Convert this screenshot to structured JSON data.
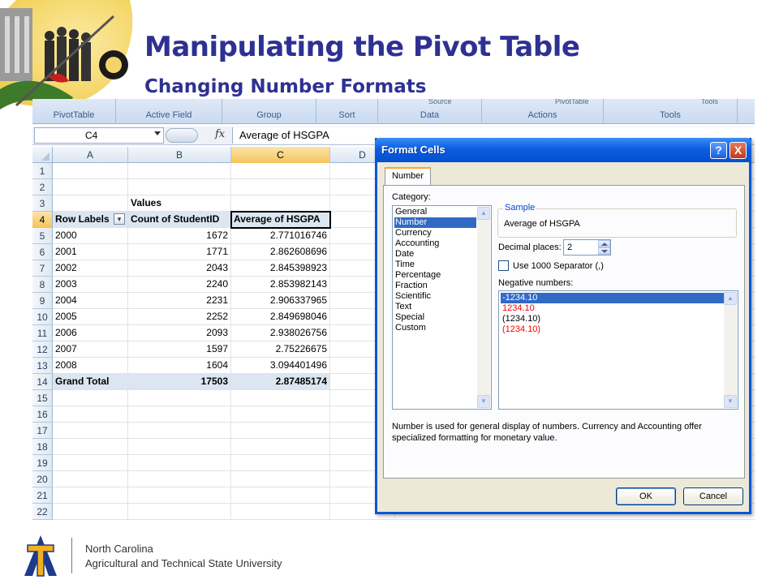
{
  "slide": {
    "title": "Manipulating the Pivot Table",
    "subtitle": "Changing Number Formats",
    "footer_line1": "North Carolina",
    "footer_line2": "Agricultural and Technical State University",
    "colors": {
      "title": "#2e3192",
      "logo_blue": "#1e3a8a",
      "logo_gold": "#f2b01e"
    }
  },
  "ribbon": {
    "groups": [
      "PivotTable",
      "Active Field",
      "Group",
      "Sort",
      "Data",
      "Actions",
      "Tools"
    ],
    "clipped_top": [
      "Source",
      "PivotTable",
      "Tools"
    ]
  },
  "formula_bar": {
    "name_box": "C4",
    "fx": "fx",
    "formula": "Average of HSGPA"
  },
  "sheet": {
    "columns": [
      "A",
      "B",
      "C",
      "D"
    ],
    "active_column": "C",
    "active_row": "4",
    "row_numbers": [
      "1",
      "2",
      "3",
      "4",
      "5",
      "6",
      "7",
      "8",
      "9",
      "10",
      "11",
      "12",
      "13",
      "14",
      "15",
      "16",
      "17",
      "18",
      "19",
      "20",
      "21",
      "22"
    ],
    "values_header": "Values",
    "headers": [
      "Row Labels",
      "Count of StudentID",
      "Average of HSGPA"
    ],
    "rows": [
      {
        "label": "2000",
        "count": "1672",
        "avg": "2.771016746"
      },
      {
        "label": "2001",
        "count": "1771",
        "avg": "2.862608696"
      },
      {
        "label": "2002",
        "count": "2043",
        "avg": "2.845398923"
      },
      {
        "label": "2003",
        "count": "2240",
        "avg": "2.853982143"
      },
      {
        "label": "2004",
        "count": "2231",
        "avg": "2.906337965"
      },
      {
        "label": "2005",
        "count": "2252",
        "avg": "2.849698046"
      },
      {
        "label": "2006",
        "count": "2093",
        "avg": "2.938026756"
      },
      {
        "label": "2007",
        "count": "1597",
        "avg": "2.75226675"
      },
      {
        "label": "2008",
        "count": "1604",
        "avg": "3.094401496"
      }
    ],
    "grand_total": {
      "label": "Grand Total",
      "count": "17503",
      "avg": "2.87485174"
    }
  },
  "dialog": {
    "title": "Format Cells",
    "help": "?",
    "close": "X",
    "tab": "Number",
    "category_label": "Category:",
    "categories": [
      "General",
      "Number",
      "Currency",
      "Accounting",
      "Date",
      "Time",
      "Percentage",
      "Fraction",
      "Scientific",
      "Text",
      "Special",
      "Custom"
    ],
    "selected_category": "Number",
    "sample_label": "Sample",
    "sample_value": "Average of HSGPA",
    "decimal_label": "Decimal places:",
    "decimal_value": "2",
    "separator_label": "Use 1000 Separator (,)",
    "separator_checked": false,
    "negative_label": "Negative numbers:",
    "negative_options": [
      {
        "text": "-1234.10",
        "color": "#ffffff",
        "selected": true
      },
      {
        "text": "1234.10",
        "color": "#ff0000",
        "selected": false
      },
      {
        "text": "(1234.10)",
        "color": "#000000",
        "selected": false
      },
      {
        "text": "(1234.10)",
        "color": "#ff0000",
        "selected": false
      }
    ],
    "description": "Number is used for general display of numbers.  Currency and Accounting offer specialized formatting for monetary value.",
    "ok": "OK",
    "cancel": "Cancel"
  }
}
